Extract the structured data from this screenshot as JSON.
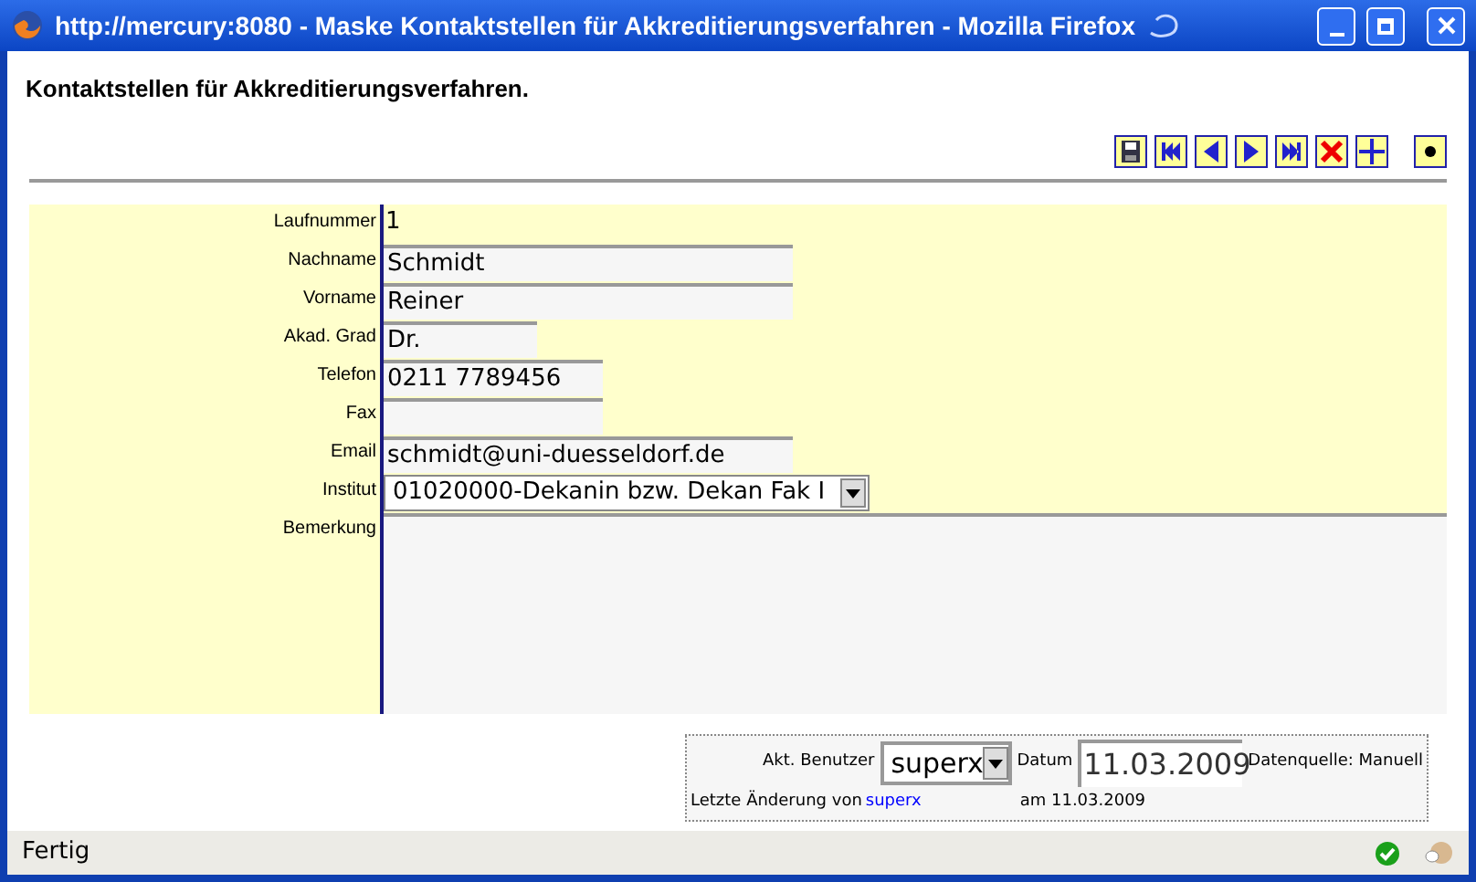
{
  "window": {
    "title": "http://mercury:8080 - Maske Kontaktstellen für Akkreditierungsverfahren - Mozilla Firefox"
  },
  "heading": "Kontaktstellen für Akkreditierungsverfahren.",
  "fields": [
    {
      "kind": "static",
      "label": "Laufnummer",
      "value": "1"
    },
    {
      "kind": "text",
      "label": "Nachname",
      "value": "Schmidt"
    },
    {
      "kind": "text",
      "label": "Vorname",
      "value": "Reiner"
    },
    {
      "kind": "text",
      "label": "Akad. Grad",
      "value": "Dr."
    },
    {
      "kind": "text",
      "label": "Telefon",
      "value": "0211 7789456"
    },
    {
      "kind": "text",
      "label": "Fax"
    },
    {
      "kind": "text",
      "label": "Email",
      "value": "schmidt@uni-duesseldorf.de"
    },
    {
      "kind": "select",
      "label": "Institut",
      "value": "01020000-Dekanin bzw. Dekan Fak I"
    },
    {
      "kind": "textarea",
      "label": "Bemerkung"
    }
  ],
  "footer": {
    "user_label": "Akt. Benutzer",
    "user": "superx",
    "date_label": "Datum",
    "date": "11.03.2009",
    "source": "Datenquelle: Manuell",
    "changed_label": "Letzte Änderung von",
    "changed_by": "superx",
    "changed_on": "am 11.03.2009"
  },
  "status_bar": {
    "text": "Fertig"
  }
}
